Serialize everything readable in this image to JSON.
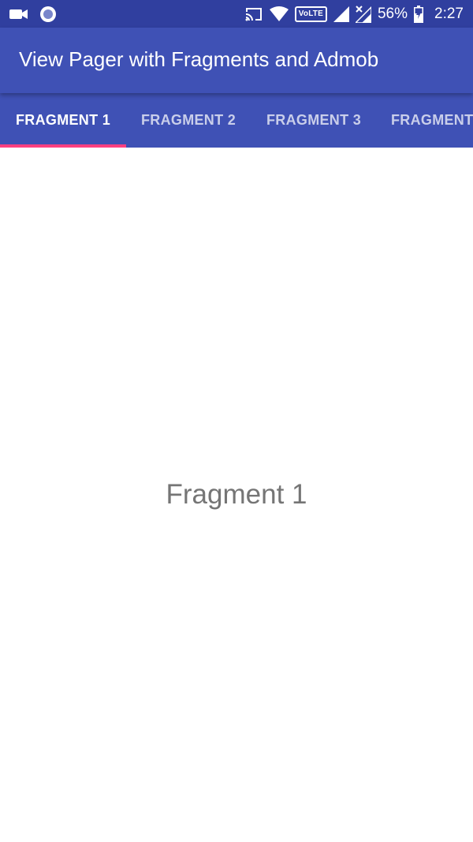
{
  "status_bar": {
    "battery_level": "56%",
    "time": "2:27",
    "network_badge": "VoLTE",
    "icons_left": [
      "video-camera-icon",
      "notification-circle-icon"
    ],
    "icons_right": [
      "cast-icon",
      "wifi-icon",
      "volte-icon",
      "cell-signal-icon",
      "cell-signal-no-data-icon",
      "battery-icon"
    ]
  },
  "app_bar": {
    "title": "View Pager with Fragments and Admob",
    "background_color": "#3f51b5"
  },
  "tabs": [
    {
      "label": "FRAGMENT 1",
      "selected": true
    },
    {
      "label": "FRAGMENT 2",
      "selected": false
    },
    {
      "label": "FRAGMENT 3",
      "selected": false
    },
    {
      "label": "FRAGMENT",
      "selected": false
    }
  ],
  "tab_indicator_color": "#ff4081",
  "content": {
    "text": "Fragment 1"
  }
}
